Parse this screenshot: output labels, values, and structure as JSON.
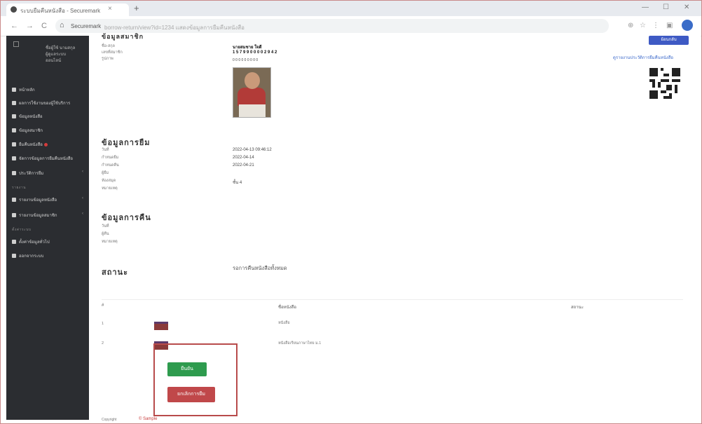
{
  "browser": {
    "tab_title": "ระบบยืมคืนหนังสือ - Securemark",
    "new_tab": "+",
    "window": {
      "minimize": "—",
      "maximize": "☐",
      "close": "✕"
    },
    "nav": {
      "back": "←",
      "forward": "→",
      "reload": "C"
    },
    "address_host": "Securemark",
    "address_url": "borrow-return/view?id=1234 แสดงข้อมูลการยืมคืนหนังสือ",
    "right_icons": [
      "⊕",
      "☆",
      "⋮",
      "▣"
    ]
  },
  "sidebar": {
    "user_lines": [
      "ชื่อผู้ใช้ นามสกุล",
      "ผู้ดูแลระบบ",
      "ออนไลน์"
    ],
    "items": [
      {
        "label": "หน้าหลัก",
        "arrow": ""
      },
      {
        "label": "ผลการใช้งานของผู้ใช้บริการ",
        "arrow": ""
      },
      {
        "label": "ข้อมูลหนังสือ",
        "arrow": ""
      },
      {
        "label": "ข้อมูลสมาชิก",
        "arrow": ""
      },
      {
        "label": "ยืมคืนหนังสือ",
        "arrow": ""
      },
      {
        "label": "จัดการข้อมูลการยืมคืนหนังสือ",
        "arrow": ""
      },
      {
        "label": "ประวัติการยืม",
        "arrow": "‹"
      }
    ],
    "section1": "รายงาน",
    "items2": [
      {
        "label": "รายงานข้อมูลหนังสือ",
        "arrow": "‹"
      },
      {
        "label": "รายงานข้อมูลสมาชิก",
        "arrow": "‹"
      }
    ],
    "section2": "ตั้งค่าระบบ",
    "items3": [
      {
        "label": "ตั้งค่าข้อมูลทั่วไป"
      },
      {
        "label": "ออกจากระบบ"
      }
    ]
  },
  "main": {
    "top_section_title": "ข้อมูลสมาชิก",
    "top_button": "ย้อนกลับ",
    "top_link": "ดูรายงานประวัติการยืมคืนหนังสือ",
    "member_labels": [
      "ชื่อ-สกุล",
      "เลขที่สมาชิก",
      "รูปภาพ"
    ],
    "member_values": [
      "นายสมชาย ใจดี",
      "1 5 7 9 9 0 0 0 0 2 9 4 2",
      "0 0 0 0 0 0 0 0 0"
    ],
    "borrow_title": "ข้อมูลการยืม",
    "borrow_labels": [
      "วันที่",
      "กำหนดยืม",
      "กำหนดคืน",
      "ผู้ยืม",
      "ห้องสมุด",
      "หมายเหตุ"
    ],
    "borrow_values": [
      "2022-04-13 09:46:12",
      "2022-04-14",
      "2022-04-21",
      "",
      "ชั้น 4",
      ""
    ],
    "return_title": "ข้อมูลการคืน",
    "return_labels": [
      "วันที่",
      "ผู้คืน",
      "หมายเหตุ"
    ],
    "status_label": "สถานะ",
    "status_value": "รอการคืนหนังสือทั้งหมด",
    "table": {
      "headers": [
        "#",
        "ชื่อหนังสือ",
        "สถานะ"
      ],
      "rows": [
        {
          "no": "1",
          "title": "หนังสือ"
        },
        {
          "no": "2",
          "title": "หนังสือเรียนภาษาไทย ม.1"
        }
      ]
    },
    "confirm_button": "ยืนยัน",
    "cancel_button": "ยกเลิกการยืม",
    "footer_text": "Copyright",
    "footer_red": "© Sample"
  }
}
